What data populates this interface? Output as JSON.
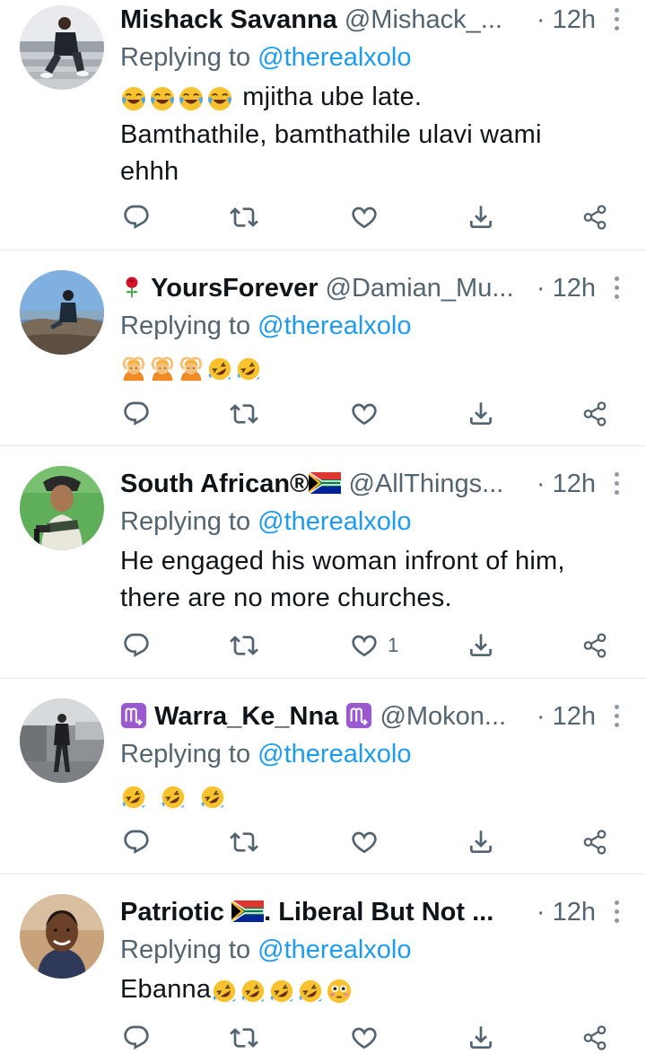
{
  "colors": {
    "accent": "#1d9bf0",
    "secondary": "#536471",
    "divider": "#e6e9eb"
  },
  "tweets": [
    {
      "name": "Mishack Savanna",
      "handle": "@Mishack_...",
      "time": "· 12h",
      "replying_prefix": "Replying to",
      "replying_to": "@therealxolo",
      "text_line1": "mjitha ube late.",
      "text_line2": "Bamthathile, bamthathile ulavi wami",
      "text_line3": "ehhh",
      "body_emojis": [
        "face-with-tears-of-joy",
        "face-with-tears-of-joy",
        "face-with-tears-of-joy",
        "face-with-tears-of-joy"
      ],
      "likes": ""
    },
    {
      "name_prefix_emoji": "🌹",
      "name": "YoursForever",
      "handle": "@Damian_Mu...",
      "time": "· 12h",
      "replying_prefix": "Replying to",
      "replying_to": "@therealxolo",
      "body_emojis": [
        "person-gesturing-ok",
        "person-gesturing-ok",
        "person-gesturing-ok",
        "rolling-on-floor-laughing",
        "rolling-on-floor-laughing"
      ],
      "likes": ""
    },
    {
      "name": "South African®",
      "name_suffix_emoji": "south-africa-flag",
      "handle": "@AllThings...",
      "time": "· 12h",
      "replying_prefix": "Replying to",
      "replying_to": "@therealxolo",
      "text_line1": "He engaged his woman infront of him,",
      "text_line2": "there are no more churches.",
      "likes": "1"
    },
    {
      "name_prefix_emoji": "♏",
      "name": "Warra_Ke_Nna",
      "name_suffix_emoji": "♏",
      "handle": "@Mokon...",
      "time": "· 12h",
      "replying_prefix": "Replying to",
      "replying_to": "@therealxolo",
      "body_emojis": [
        "rolling-on-floor-laughing",
        "rolling-on-floor-laughing",
        "rolling-on-floor-laughing"
      ],
      "likes": ""
    },
    {
      "name": "Patriotic",
      "name_mid_emoji": "south-africa-flag",
      "name_rest": ". Liberal But Not ...",
      "time": "· 12h",
      "replying_prefix": "Replying to",
      "replying_to": "@therealxolo",
      "text_line1": "Ebanna",
      "body_emojis": [
        "rolling-on-floor-laughing",
        "rolling-on-floor-laughing",
        "rolling-on-floor-laughing",
        "rolling-on-floor-laughing",
        "flushed-face"
      ],
      "likes": ""
    }
  ]
}
